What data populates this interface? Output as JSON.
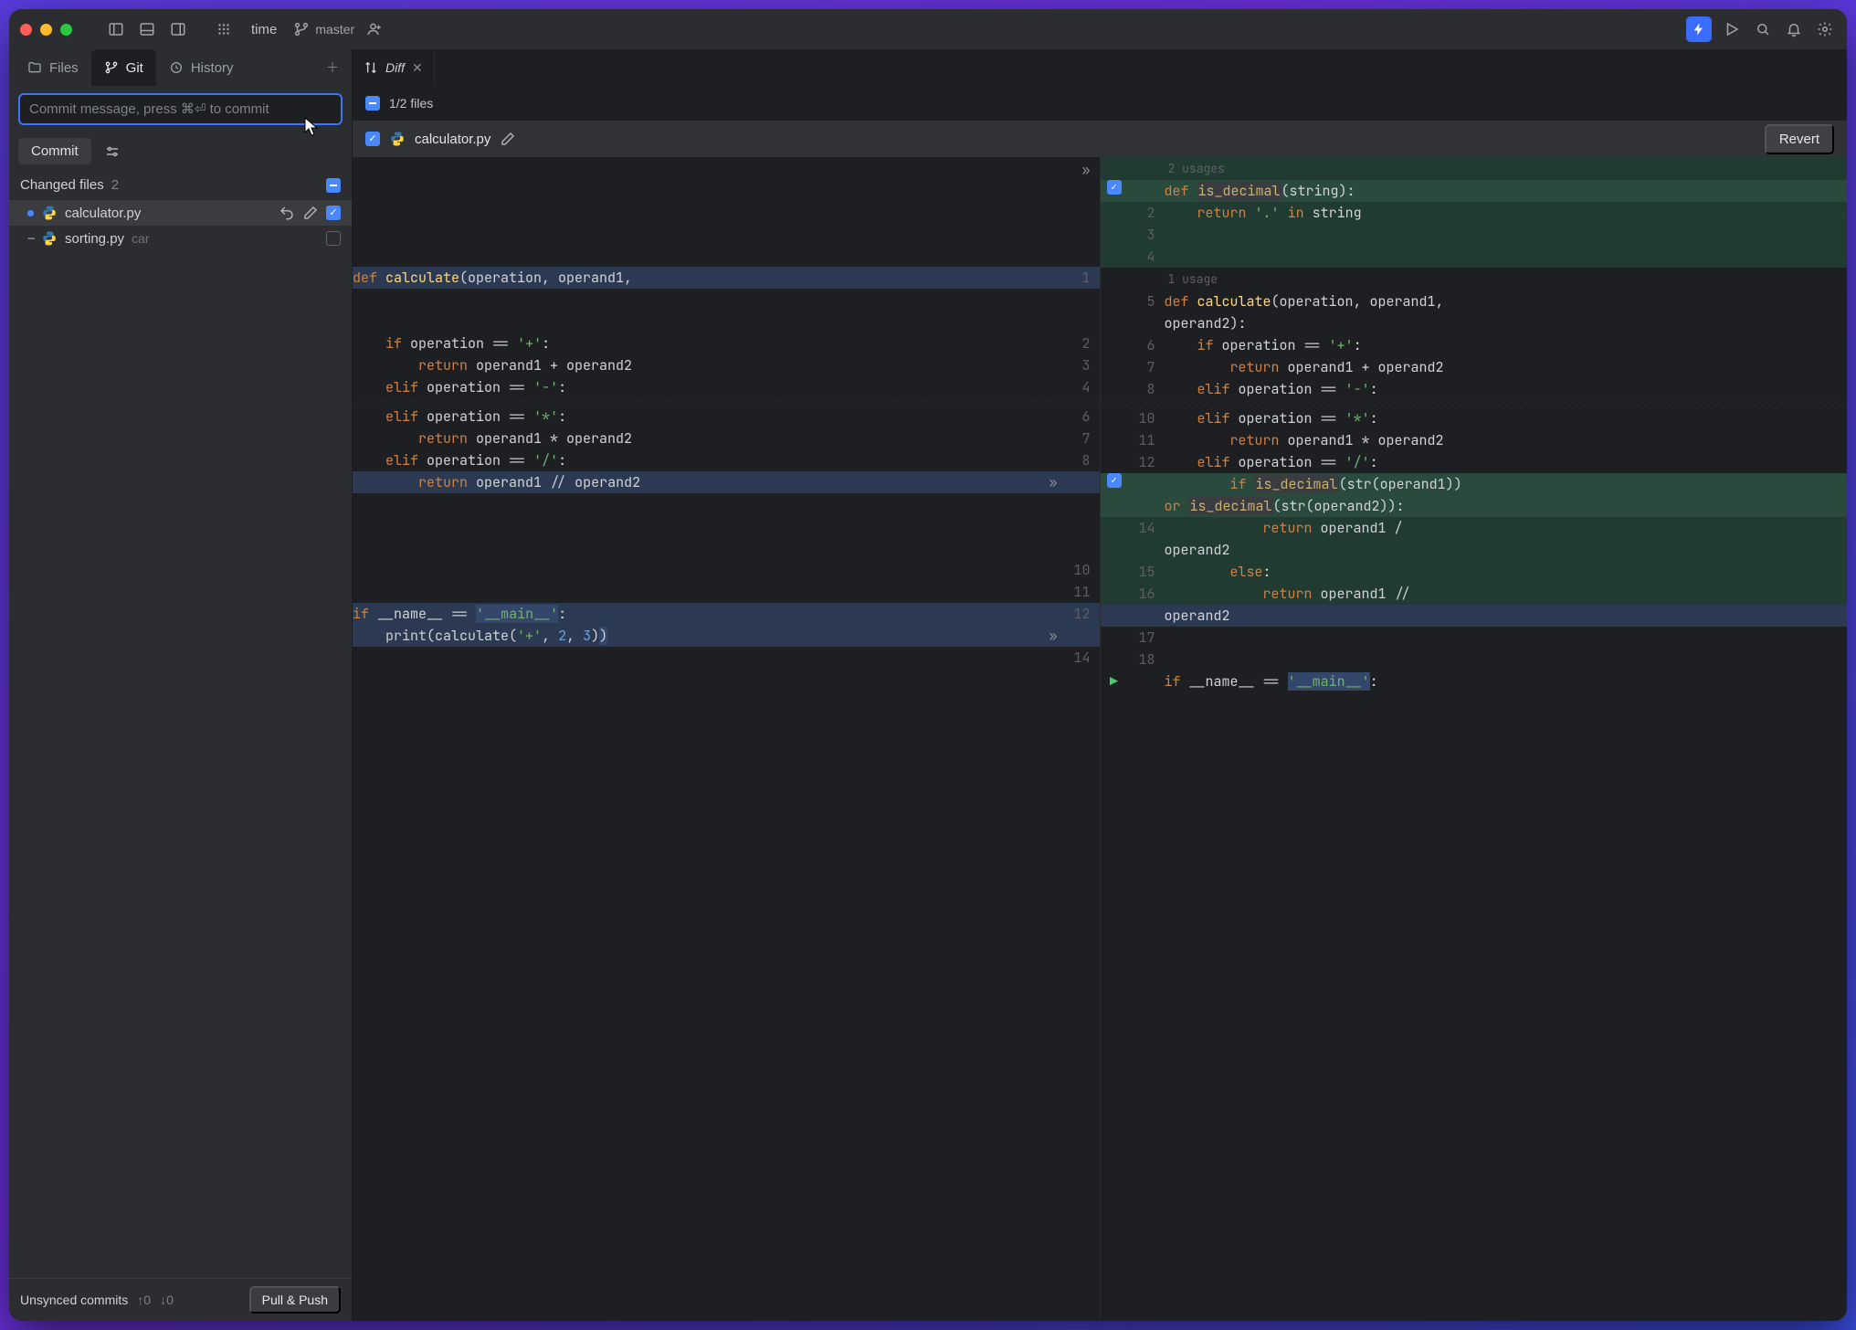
{
  "titlebar": {
    "project": "time",
    "branch": "master"
  },
  "left_tabs": {
    "files": "Files",
    "git": "Git",
    "history": "History"
  },
  "commit": {
    "placeholder": "Commit message, press ⌘⏎ to commit",
    "button": "Commit"
  },
  "changed": {
    "title": "Changed files",
    "count": "2",
    "files": [
      {
        "name": "calculator.py",
        "status": "modified",
        "checked": true,
        "selected": true
      },
      {
        "name": "sorting.py",
        "status": "deleted",
        "checked": false,
        "tag": "car"
      }
    ]
  },
  "unsynced": {
    "title": "Unsynced commits",
    "up": "↑0",
    "down": "↓0",
    "button": "Pull & Push"
  },
  "editor_tab": {
    "label": "Diff"
  },
  "diff_header": {
    "summary": "1/2 files"
  },
  "file_header": {
    "name": "calculator.py",
    "revert": "Revert"
  },
  "diff": {
    "left": [
      {
        "n": "",
        "cls": "",
        "html": ""
      },
      {
        "n": "",
        "cls": "",
        "html": ""
      },
      {
        "n": "",
        "cls": "",
        "html": ""
      },
      {
        "n": "",
        "cls": "",
        "html": ""
      },
      {
        "n": "",
        "cls": "",
        "html": ""
      },
      {
        "n": "1",
        "cls": "bg-mod",
        "html": "<span class='kw'>def</span> <span class='fn'>calculate</span>(operation, operand1,"
      },
      {
        "n": "",
        "cls": "",
        "html": ""
      },
      {
        "n": "",
        "cls": "",
        "html": ""
      },
      {
        "n": "2",
        "cls": "",
        "html": "    <span class='kw'>if</span> operation <span class='op'>==</span> <span class='str'>'+'</span>:"
      },
      {
        "n": "3",
        "cls": "",
        "html": "        <span class='kw'>return</span> operand1 + operand2"
      },
      {
        "n": "4",
        "cls": "",
        "html": "    <span class='kw'>elif</span> operation <span class='op'>==</span> <span class='str'>'-'</span>:"
      },
      {
        "fold": true
      },
      {
        "n": "6",
        "cls": "",
        "html": "    <span class='kw'>elif</span> operation <span class='op'>==</span> <span class='str'>'*'</span>:"
      },
      {
        "n": "7",
        "cls": "",
        "html": "        <span class='kw'>return</span> operand1 * operand2"
      },
      {
        "n": "8",
        "cls": "",
        "html": "    <span class='kw'>elif</span> operation <span class='op'>==</span> <span class='str'>'/'</span>:"
      },
      {
        "n": "",
        "cls": "bg-mod",
        "html": "        <span class='kw'>return</span> operand1 <span class='op'>//</span> operand2",
        "chev": true
      },
      {
        "n": "",
        "cls": "",
        "html": ""
      },
      {
        "n": "",
        "cls": "",
        "html": ""
      },
      {
        "n": "",
        "cls": "",
        "html": ""
      },
      {
        "n": "10",
        "cls": "",
        "html": ""
      },
      {
        "n": "11",
        "cls": "",
        "html": ""
      },
      {
        "n": "12",
        "cls": "bg-mod",
        "html": "<span class='kw'>if</span> __name__ <span class='op'>==</span> <span class='str sel-bg'>'__main__'</span>:"
      },
      {
        "n": "",
        "cls": "bg-mod",
        "html": "    <span class='id'>print</span>(calculate(<span class='str'>'+'</span>, <span class='num'>2</span>, <span class='num'>3</span>)<span class='sel-bg'>)</span>",
        "chev": true
      },
      {
        "n": "14",
        "cls": "",
        "html": ""
      }
    ],
    "right": [
      {
        "n": "",
        "cls": "bg-add",
        "hint": "2 usages"
      },
      {
        "n": "",
        "cls": "bg-add-strong",
        "chk": true,
        "html": "<span class='kw'>def</span> <span class='fn-ul'>is_decimal</span>(string):"
      },
      {
        "n": "2",
        "cls": "bg-add",
        "html": "    <span class='kw'>return</span> <span class='str'>'.'</span> <span class='kw'>in</span> string"
      },
      {
        "n": "3",
        "cls": "bg-add",
        "html": ""
      },
      {
        "n": "4",
        "cls": "bg-add",
        "html": ""
      },
      {
        "n": "",
        "cls": "",
        "hint": "1 usage"
      },
      {
        "n": "5",
        "cls": "",
        "html": "<span class='kw'>def</span> <span class='fn'>calculate</span>(operation, operand1,"
      },
      {
        "n": "",
        "cls": "",
        "html": "operand2):"
      },
      {
        "n": "6",
        "cls": "",
        "html": "    <span class='kw'>if</span> operation <span class='op'>==</span> <span class='str'>'+'</span>:"
      },
      {
        "n": "7",
        "cls": "",
        "html": "        <span class='kw'>return</span> operand1 + operand2"
      },
      {
        "n": "8",
        "cls": "",
        "html": "    <span class='kw'>elif</span> operation <span class='op'>==</span> <span class='str'>'-'</span>:"
      },
      {
        "fold": true
      },
      {
        "n": "10",
        "cls": "",
        "html": "    <span class='kw'>elif</span> operation <span class='op'>==</span> <span class='str'>'*'</span>:"
      },
      {
        "n": "11",
        "cls": "",
        "html": "        <span class='kw'>return</span> operand1 * operand2"
      },
      {
        "n": "12",
        "cls": "",
        "html": "    <span class='kw'>elif</span> operation <span class='op'>==</span> <span class='str'>'/'</span>:"
      },
      {
        "n": "",
        "cls": "bg-add-strong",
        "chk": true,
        "html": "        <span class='kw'>if</span> <span class='fn-ul'>is_decimal</span>(str(operand1))"
      },
      {
        "n": "",
        "cls": "bg-add-strong",
        "html": "<span class='kw'>or</span> <span class='fn-ul'>is_decimal</span>(str(operand2)):"
      },
      {
        "n": "14",
        "cls": "bg-add",
        "html": "            <span class='kw'>return</span> operand1 /"
      },
      {
        "n": "",
        "cls": "bg-add",
        "html": "operand2"
      },
      {
        "n": "15",
        "cls": "bg-add",
        "html": "        <span class='kw'>else</span>:"
      },
      {
        "n": "16",
        "cls": "bg-add",
        "html": "            <span class='kw'>return</span> operand1 <span class='op'>//</span>"
      },
      {
        "n": "",
        "cls": "bg-mod",
        "html": "operand2"
      },
      {
        "n": "17",
        "cls": "",
        "html": ""
      },
      {
        "n": "18",
        "cls": "",
        "html": ""
      },
      {
        "n": "",
        "cls": "",
        "play": true,
        "html": "<span class='kw'>if</span> __name__ <span class='op'>==</span> <span class='str sel-bg'>'__main__'</span>:"
      }
    ]
  }
}
